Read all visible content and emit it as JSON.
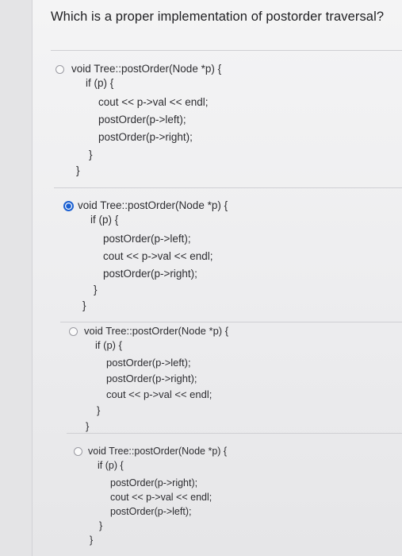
{
  "question": "Which is a proper implementation of postorder traversal?",
  "options": [
    {
      "selected": false,
      "lines": [
        "void Tree::postOrder(Node *p) {",
        "if (p) {",
        "cout << p->val << endl;",
        "postOrder(p->left);",
        "postOrder(p->right);",
        "}",
        "}"
      ]
    },
    {
      "selected": true,
      "lines": [
        "void Tree::postOrder(Node *p) {",
        "if (p) {",
        "postOrder(p->left);",
        "cout << p->val << endl;",
        "postOrder(p->right);",
        "}",
        "}"
      ]
    },
    {
      "selected": false,
      "lines": [
        "void Tree::postOrder(Node *p) {",
        "if (p) {",
        "postOrder(p->left);",
        "postOrder(p->right);",
        "cout << p->val << endl;",
        "}",
        "}"
      ]
    },
    {
      "selected": false,
      "lines": [
        "void Tree::postOrder(Node *p) {",
        "if (p) {",
        "postOrder(p->right);",
        "cout << p->val << endl;",
        "postOrder(p->left);",
        "}",
        "}"
      ]
    }
  ],
  "colors": {
    "accent": "#1a5fd1"
  }
}
